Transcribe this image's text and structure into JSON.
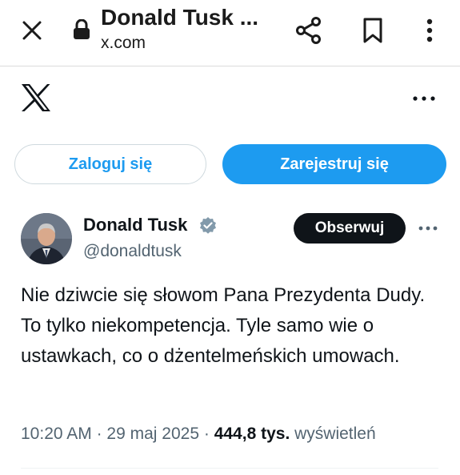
{
  "browser": {
    "title": "Donald Tusk ...",
    "url": "x.com",
    "icons": [
      "close-icon",
      "lock-icon",
      "share-icon",
      "bookmark-icon",
      "more-vertical-icon"
    ]
  },
  "header": {
    "logo": "x-logo-icon",
    "more_icon": "more-horizontal-icon"
  },
  "auth": {
    "login_label": "Zaloguj się",
    "register_label": "Zarejestruj się"
  },
  "tweet": {
    "author_name": "Donald Tusk",
    "author_handle": "@donaldtusk",
    "follow_label": "Obserwuj",
    "text": "Nie dziwcie się słowom Pana Prezydenta Dudy. To tylko niekompetencja. Tyle samo wie o ustawkach, co o dżentelmeńskich umowach.",
    "time": "10:20 AM",
    "separator": "·",
    "date": "29 maj 2025",
    "views_count": "444,8 tys.",
    "views_label": "wyświetleń"
  },
  "colors": {
    "accent": "#1d9bf0",
    "text_primary": "#0f1419",
    "text_secondary": "#536471",
    "follow_bg": "#0f1419"
  }
}
